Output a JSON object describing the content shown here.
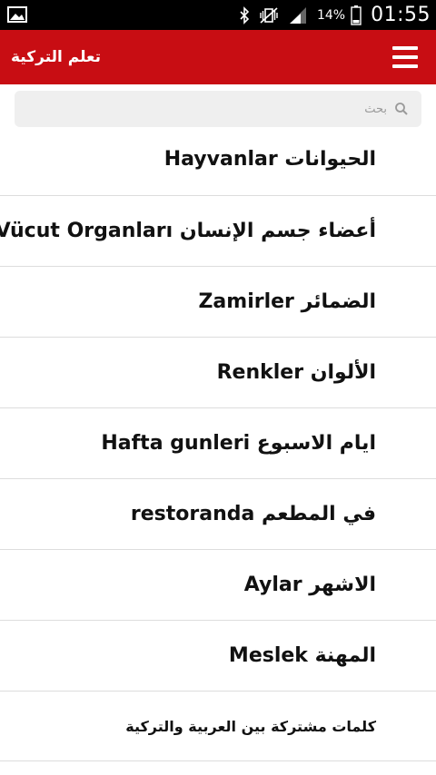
{
  "status_bar": {
    "battery_percent": "14%",
    "time": "01:55",
    "icons": [
      "image-icon",
      "bluetooth-icon",
      "vibrate-mute-icon",
      "signal-icon",
      "battery-icon"
    ]
  },
  "app_bar": {
    "title": "تعلم التركية",
    "menu_icon": "hamburger-menu-icon",
    "color": "#c80d13"
  },
  "search": {
    "placeholder": "بحث",
    "icon": "search-icon"
  },
  "list": {
    "items": [
      {
        "label": "Hayvanlar الحيوانات"
      },
      {
        "label": "Vücut Organları أعضاء جسم الإنسان"
      },
      {
        "label": "Zamirler الضمائر"
      },
      {
        "label": "Renkler الألوان"
      },
      {
        "label": "Hafta gunleri ايام الاسبوع"
      },
      {
        "label": "restoranda في المطعم"
      },
      {
        "label": "Aylar الاشهر"
      },
      {
        "label": "Meslek المهنة"
      },
      {
        "label": "كلمات مشتركة بين العربية والتركية"
      }
    ]
  }
}
